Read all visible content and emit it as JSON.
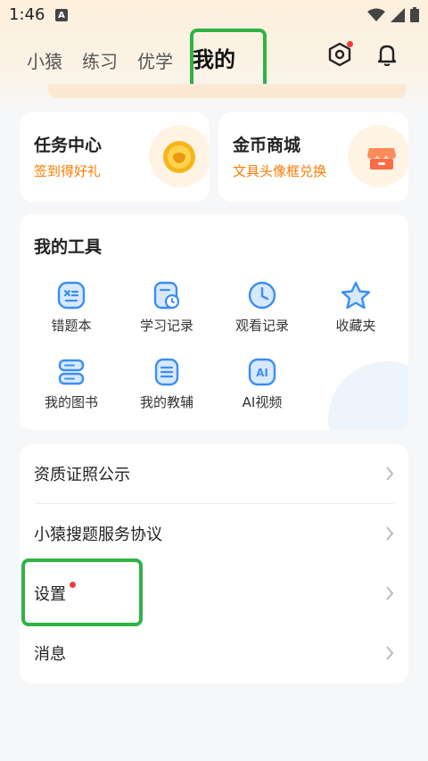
{
  "status": {
    "time": "1:46",
    "notif_letter": "A"
  },
  "tabs": [
    {
      "label": "小猿"
    },
    {
      "label": "练习"
    },
    {
      "label": "优学"
    },
    {
      "label": "我的"
    }
  ],
  "cards": {
    "task": {
      "title": "任务中心",
      "subtitle": "签到得好礼"
    },
    "coin": {
      "title": "金币商城",
      "subtitle": "文具头像框兑换"
    }
  },
  "tools": {
    "title": "我的工具",
    "items": [
      {
        "label": "错题本",
        "icon": "wrong-book-icon"
      },
      {
        "label": "学习记录",
        "icon": "study-record-icon"
      },
      {
        "label": "观看记录",
        "icon": "watch-history-icon"
      },
      {
        "label": "收藏夹",
        "icon": "favorites-icon"
      },
      {
        "label": "我的图书",
        "icon": "books-icon"
      },
      {
        "label": "我的教辅",
        "icon": "tutoring-icon"
      },
      {
        "label": "AI视频",
        "icon": "ai-video-icon"
      }
    ]
  },
  "menu": [
    {
      "label": "资质证照公示"
    },
    {
      "label": "小猿搜题服务协议"
    },
    {
      "label": "设置"
    },
    {
      "label": "消息"
    }
  ],
  "colors": {
    "accent": "#ff7a00",
    "icon_blue": "#3a8ef6",
    "highlight": "#2fb344"
  }
}
